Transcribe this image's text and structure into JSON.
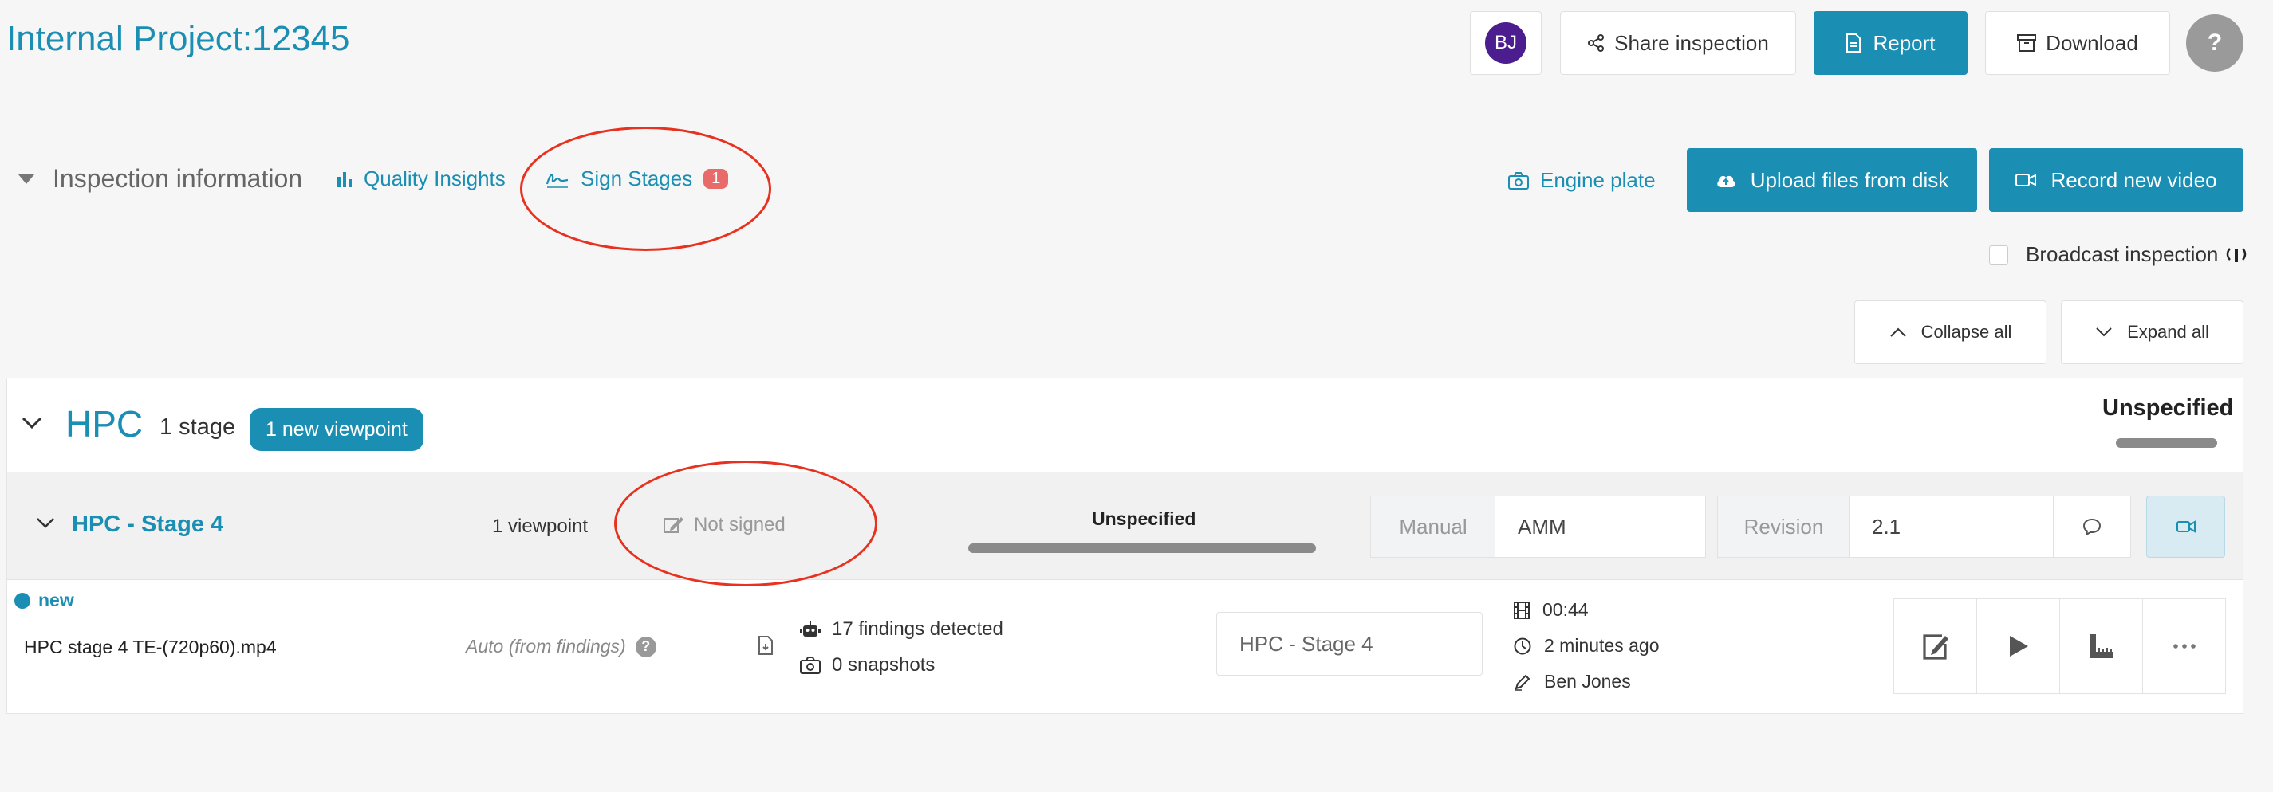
{
  "header": {
    "project_title": "Internal Project:12345",
    "avatar_initials": "BJ",
    "share_label": "Share inspection",
    "report_label": "Report",
    "download_label": "Download",
    "help_label": "?"
  },
  "toolbar": {
    "inspection_info_label": "Inspection information",
    "quality_insights_label": "Quality Insights",
    "sign_stages_label": "Sign Stages",
    "sign_stages_badge": "1",
    "engine_plate_label": "Engine plate",
    "upload_label": "Upload files from disk",
    "record_label": "Record new video",
    "broadcast_label": "Broadcast inspection",
    "collapse_all_label": "Collapse all",
    "expand_all_label": "Expand all"
  },
  "section": {
    "title": "HPC",
    "stage_count": "1 stage",
    "new_viewpoint_badge": "1 new viewpoint",
    "status": "Unspecified"
  },
  "stage": {
    "title": "HPC - Stage 4",
    "viewpoint_count": "1 viewpoint",
    "sign_status": "Not signed",
    "status": "Unspecified",
    "manual_label": "Manual",
    "manual_value": "AMM",
    "revision_label": "Revision",
    "revision_value": "2.1"
  },
  "file": {
    "new_tag": "new",
    "filename": "HPC stage 4 TE-(720p60).mp4",
    "auto_text": "Auto (from findings)",
    "findings": "17 findings detected",
    "snapshots": "0 snapshots",
    "stage_field_value": "HPC - Stage 4",
    "duration": "00:44",
    "time_ago": "2 minutes ago",
    "author": "Ben Jones"
  },
  "colors": {
    "accent": "#1a8fb3",
    "avatar": "#4b1d8f",
    "badge_red": "#e86a6a",
    "annotation_red": "#e8321f"
  }
}
